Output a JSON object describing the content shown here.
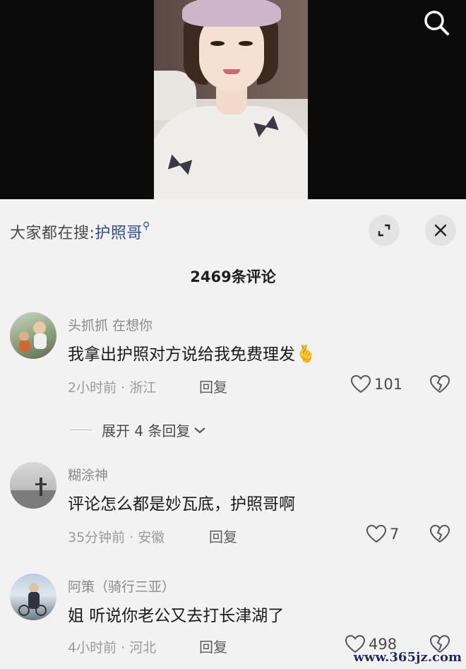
{
  "search_bar": {
    "prefix": "大家都在搜:",
    "term": "护照哥",
    "term_icon": "magnifier-small-icon"
  },
  "comment_count": "2469条评论",
  "buttons": {
    "expand_icon": "expand-corner-icon",
    "close_icon": "close-icon",
    "search_icon": "search-icon"
  },
  "comments": [
    {
      "user": "头抓抓 在想你",
      "text": "我拿出护照对方说给我免费理发",
      "emoji": "🫰",
      "time": "2小时前 · 浙江",
      "reply": "回复",
      "likes": "101"
    },
    {
      "user": "糊涂神",
      "text": "评论怎么都是妙瓦底，护照哥啊",
      "time": "35分钟前 · 安徽",
      "reply": "回复",
      "likes": "7"
    },
    {
      "user": "阿策（骑行三亚）",
      "text": "姐 听说你老公又去打长津湖了",
      "time": "4小时前 · 河北",
      "reply": "回复",
      "likes": "498"
    }
  ],
  "expand_replies": "展开 4 条回复",
  "watermark": "www.365jz.com",
  "colors": {
    "panel_bg": "#f2f2f2",
    "search_term": "#2a4d8f",
    "video_bg": "#0b0b0b"
  }
}
